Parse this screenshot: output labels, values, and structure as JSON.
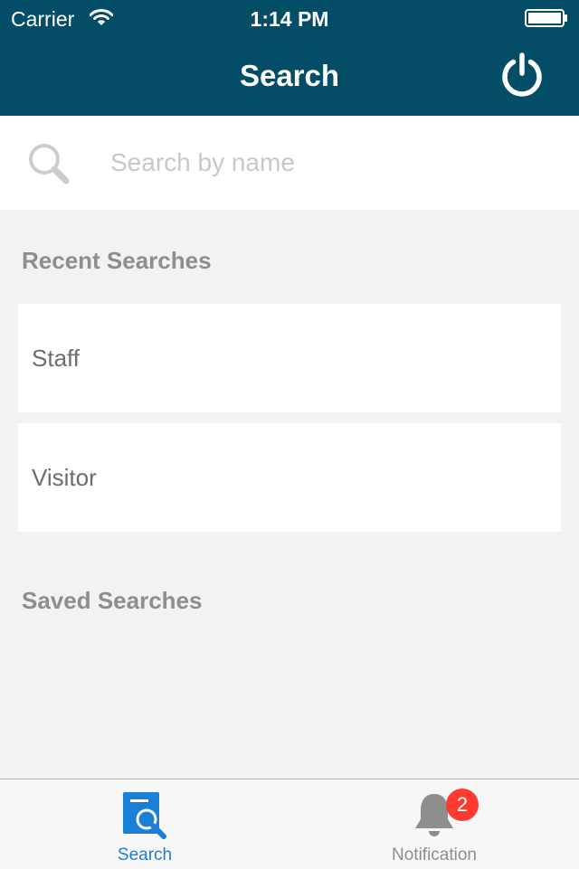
{
  "status_bar": {
    "carrier": "Carrier",
    "time": "1:14 PM",
    "wifi_icon": "wifi-icon",
    "battery_icon": "battery-icon"
  },
  "nav_bar": {
    "title": "Search",
    "right_button_icon": "power-icon",
    "background_color": "#044d66"
  },
  "search": {
    "icon": "search-icon",
    "placeholder": "Search by name",
    "value": ""
  },
  "recent_searches": {
    "header": "Recent Searches",
    "items": [
      {
        "label": "Staff"
      },
      {
        "label": "Visitor"
      }
    ]
  },
  "saved_searches": {
    "header": "Saved Searches",
    "items": []
  },
  "tab_bar": {
    "tabs": [
      {
        "label": "Search",
        "icon": "search-document-icon",
        "selected": true,
        "color": "#1a7fd6"
      },
      {
        "label": "Notification",
        "icon": "bell-icon",
        "selected": false,
        "badge": "2",
        "color": "#8e8e8e"
      }
    ],
    "badge_color": "#ff3b30"
  }
}
